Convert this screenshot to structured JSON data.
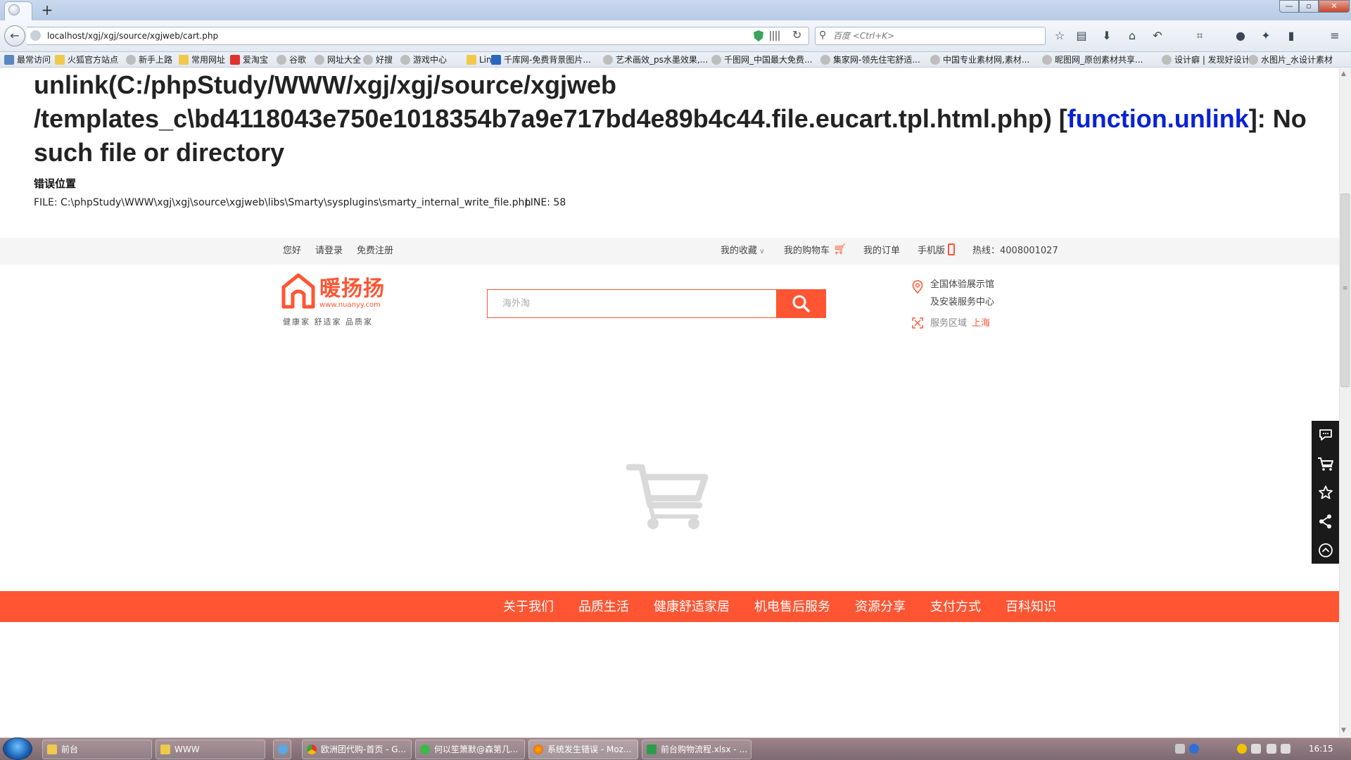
{
  "browser": {
    "url": "localhost/xgj/xgj/source/xgjweb/cart.php",
    "search_placeholder": "百度 <Ctrl+K>",
    "window_buttons": {
      "min": "—",
      "max": "▫",
      "close": "✕"
    },
    "bookmarks": [
      "最常访问",
      "火狐官方站点",
      "新手上路",
      "常用网址",
      "爱淘宝",
      "谷歌",
      "网址大全",
      "好搜",
      "游戏中心",
      "Links",
      "千库网-免费背景图片...",
      "艺术画效_ps水墨效果,...",
      "千图网_中国最大免费...",
      "集家网-领先住宅舒适...",
      "中国专业素材网,素材...",
      "昵图网_原创素材共享...",
      "设计癖 | 发现好设计",
      "水图片_水设计素材"
    ]
  },
  "error": {
    "title_part1": "unlink(C:/phpStudy/WWW/xgj/xgj/source/xgjweb",
    "title_part2": "/templates_c\\bd4118043e750e1018354b7a9e717bd4e89b4c44.file.eucart.tpl.html.php) [",
    "title_link": "function.unlink",
    "title_part3": "]: No",
    "title_part4": "such file or directory",
    "location_heading": "错误位置",
    "file": "FILE: C:\\phpStudy\\WWW\\xgj\\xgj\\source\\xgjweb\\libs\\Smarty\\sysplugins\\smarty_internal_write_file.php",
    "line": "LINE: 58"
  },
  "topbar": {
    "hello": "您好",
    "login": "请登录",
    "register": "免费注册",
    "favorites": "我的收藏",
    "cart": "我的购物车",
    "orders": "我的订单",
    "mobile": "手机版",
    "hotline": "热线：4008001027"
  },
  "logo": {
    "name": "暖扬扬",
    "url": "www.nuanyy.com",
    "slogan": "健康家  舒适家  品质家"
  },
  "search": {
    "placeholder": "海外淘"
  },
  "store": {
    "line1": "全国体验展示馆",
    "line2": "及安装服务中心",
    "area_label": "服务区域",
    "area_value": "上海"
  },
  "footer_nav": [
    "关于我们",
    "品质生活",
    "健康舒适家居",
    "机电售后服务",
    "资源分享",
    "支付方式",
    "百科知识"
  ],
  "side_tools": [
    "chat-icon",
    "cart-icon",
    "star-icon",
    "share-icon",
    "back-to-top-icon"
  ],
  "taskbar": {
    "items": [
      "前台",
      "WWW",
      "欧洲团代购-首页 - G...",
      "何以笙箫默@森第几...",
      "系统发生错误 - Moz...",
      "前台购物流程.xlsx - ..."
    ],
    "time": "16:15"
  },
  "colors": {
    "brand": "#ff5533",
    "link": "#0a22d4"
  }
}
